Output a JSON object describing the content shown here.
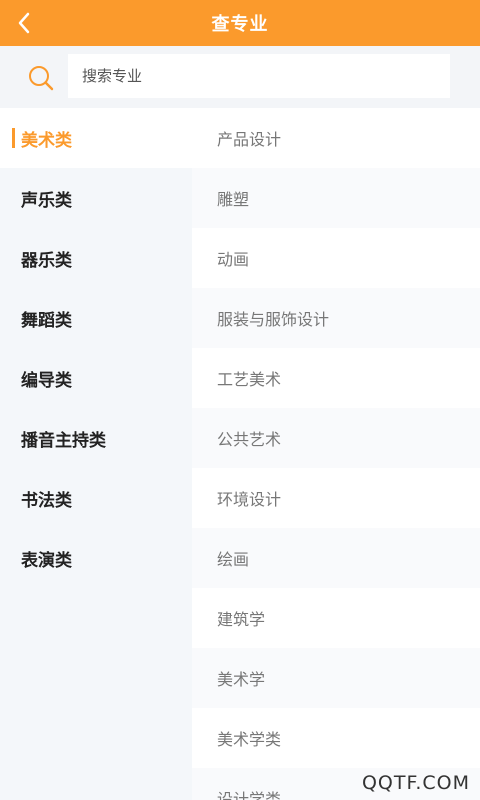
{
  "header": {
    "title": "查专业",
    "accent_color": "#fb9a2c",
    "back_icon": "chevron-left-icon"
  },
  "search": {
    "placeholder": "搜索专业",
    "icon": "search-icon"
  },
  "categories": [
    {
      "label": "美术类",
      "active": true
    },
    {
      "label": "声乐类",
      "active": false
    },
    {
      "label": "器乐类",
      "active": false
    },
    {
      "label": "舞蹈类",
      "active": false
    },
    {
      "label": "编导类",
      "active": false
    },
    {
      "label": "播音主持类",
      "active": false
    },
    {
      "label": "书法类",
      "active": false
    },
    {
      "label": "表演类",
      "active": false
    }
  ],
  "majors": [
    "产品设计",
    "雕塑",
    "动画",
    "服装与服饰设计",
    "工艺美术",
    "公共艺术",
    "环境设计",
    "绘画",
    "建筑学",
    "美术学",
    "美术学类",
    "设计学类"
  ],
  "watermark": "QQTF.COM"
}
